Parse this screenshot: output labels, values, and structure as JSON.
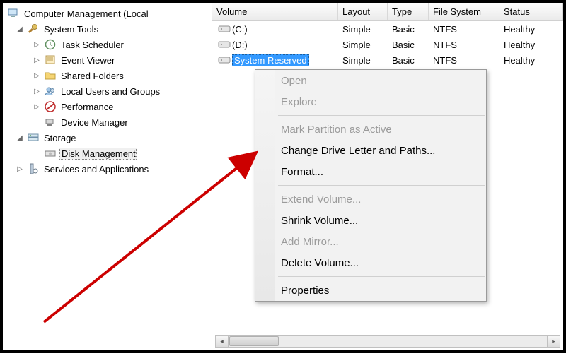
{
  "tree": {
    "root": "Computer Management (Local",
    "system_tools": "System Tools",
    "task_scheduler": "Task Scheduler",
    "event_viewer": "Event Viewer",
    "shared_folders": "Shared Folders",
    "local_users": "Local Users and Groups",
    "performance": "Performance",
    "device_manager": "Device Manager",
    "storage": "Storage",
    "disk_management": "Disk Management",
    "services_apps": "Services and Applications"
  },
  "columns": {
    "volume": "Volume",
    "layout": "Layout",
    "type": "Type",
    "fs": "File System",
    "status": "Status"
  },
  "volumes": [
    {
      "name": "(C:)",
      "layout": "Simple",
      "type": "Basic",
      "fs": "NTFS",
      "status": "Healthy"
    },
    {
      "name": "(D:)",
      "layout": "Simple",
      "type": "Basic",
      "fs": "NTFS",
      "status": "Healthy"
    },
    {
      "name": "System Reserved",
      "layout": "Simple",
      "type": "Basic",
      "fs": "NTFS",
      "status": "Healthy"
    }
  ],
  "menu": {
    "open": "Open",
    "explore": "Explore",
    "mark_active": "Mark Partition as Active",
    "change_letter": "Change Drive Letter and Paths...",
    "format": "Format...",
    "extend": "Extend Volume...",
    "shrink": "Shrink Volume...",
    "add_mirror": "Add Mirror...",
    "delete": "Delete Volume...",
    "properties": "Properties"
  }
}
